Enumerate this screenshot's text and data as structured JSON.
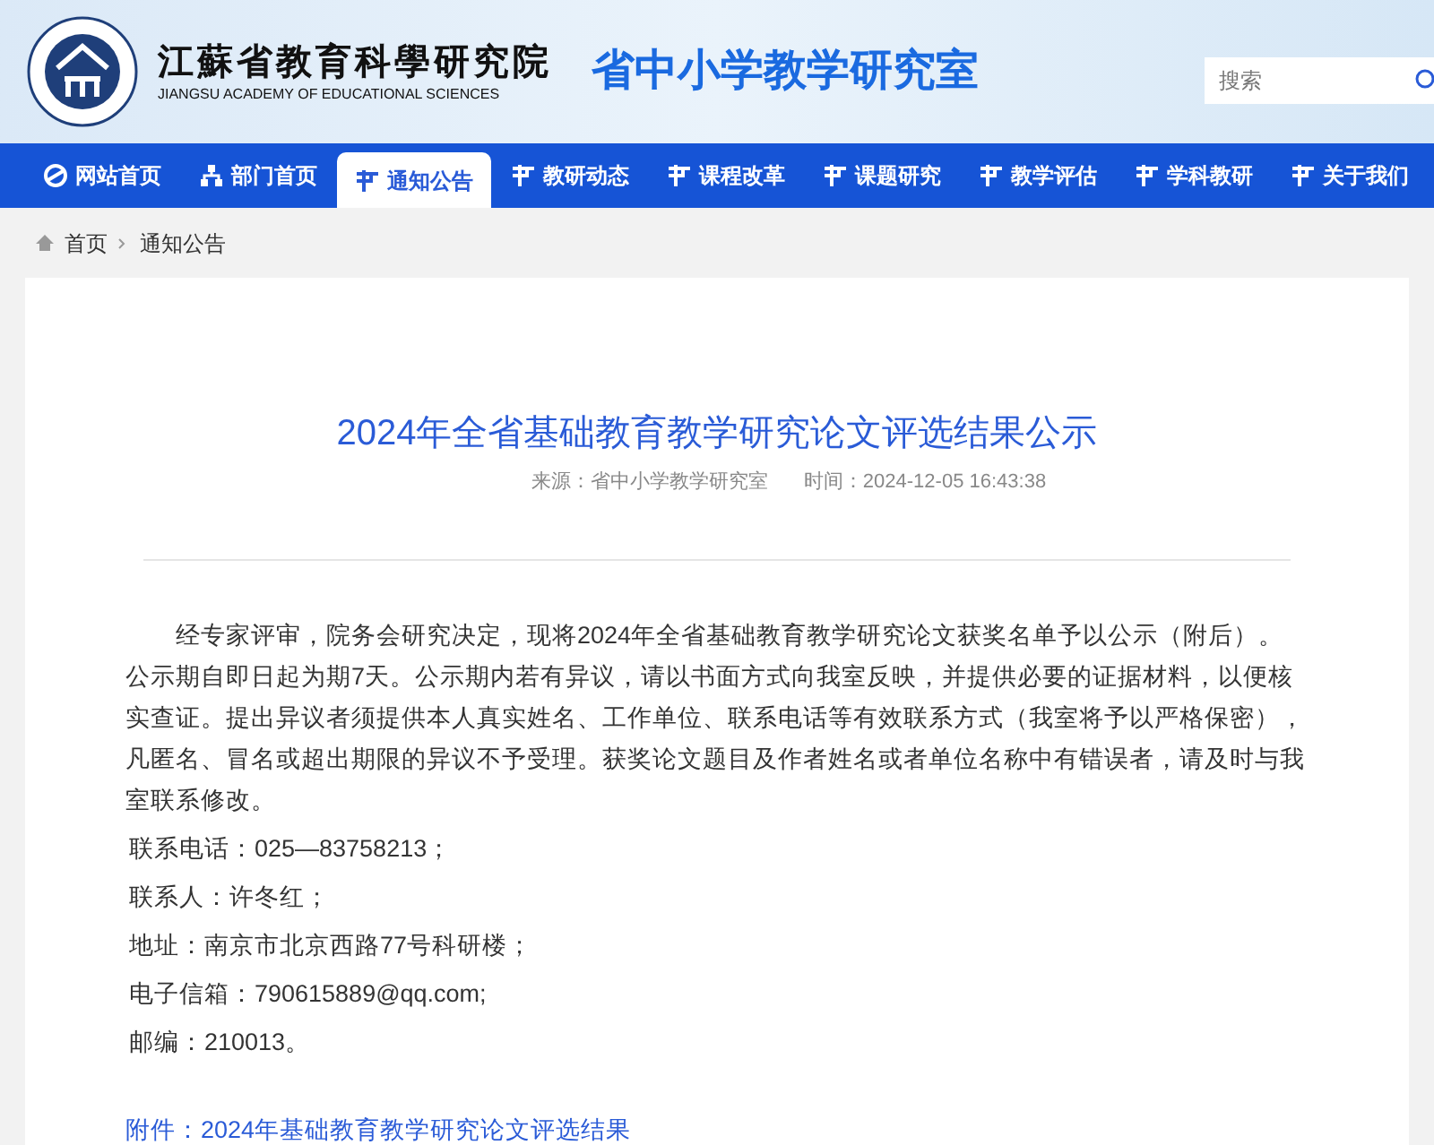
{
  "header": {
    "org_name": "江蘇省教育科學研究院",
    "org_name_en": "JIANGSU ACADEMY OF EDUCATIONAL SCIENCES",
    "site_title": "省中小学教学研究室",
    "search": {
      "placeholder": "搜索"
    }
  },
  "nav": [
    {
      "label": "网站首页",
      "kind": "home",
      "selected": false
    },
    {
      "label": "部门首页",
      "kind": "department",
      "selected": false
    },
    {
      "label": "通知公告",
      "kind": "section",
      "selected": true
    },
    {
      "label": "教研动态",
      "kind": "section",
      "selected": false
    },
    {
      "label": "课程改革",
      "kind": "section",
      "selected": false
    },
    {
      "label": "课题研究",
      "kind": "section",
      "selected": false
    },
    {
      "label": "教学评估",
      "kind": "section",
      "selected": false
    },
    {
      "label": "学科教研",
      "kind": "section",
      "selected": false
    },
    {
      "label": "关于我们",
      "kind": "section",
      "selected": false
    }
  ],
  "breadcrumb": [
    {
      "label": "首页"
    },
    {
      "label": "通知公告"
    }
  ],
  "article": {
    "title": "2024年全省基础教育教学研究论文评选结果公示",
    "source": "来源：省中小学教学研究室",
    "time": "时间：2024-12-05 16:43:38",
    "paragraph": "经专家评审，院务会研究决定，现将2024年全省基础教育教学研究论文获奖名单予以公示（附后）。公示期自即日起为期7天。公示期内若有异议，请以书面方式向我室反映，并提供必要的证据材料，以便核实查证。提出异议者须提供本人真实姓名、工作单位、联系电话等有效联系方式（我室将予以严格保密），凡匿名、冒名或超出期限的异议不予受理。获奖论文题目及作者姓名或者单位名称中有错误者，请及时与我室联系修改。",
    "contacts": [
      "联系电话：025—83758213；",
      "联系人：许冬红；",
      "地址：南京市北京西路77号科研楼；",
      "电子信箱：790615889@qq.com;",
      "邮编：210013。"
    ],
    "attachment": "附件：2024年基础教育教学研究论文评选结果"
  }
}
